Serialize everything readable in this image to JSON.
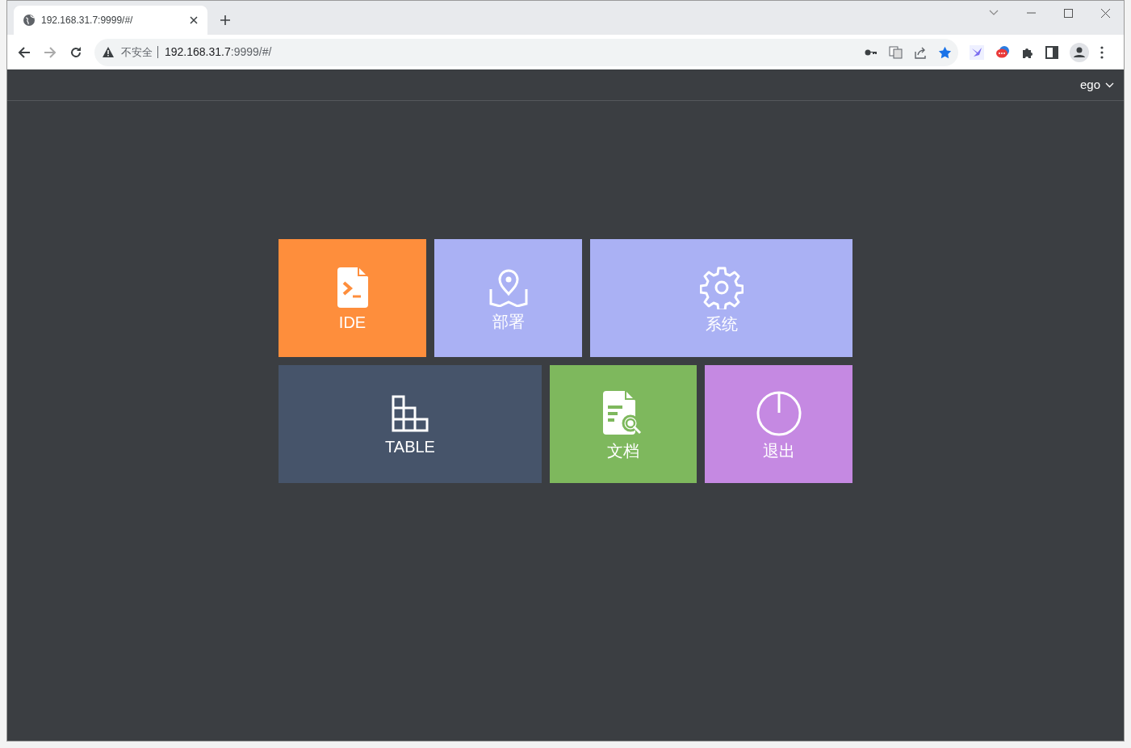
{
  "browser": {
    "tabs": [
      {
        "title": "192.168.31.7:9999/#/",
        "selected": true
      }
    ],
    "address_bar": {
      "security_label": "不安全",
      "host": "192.168.31.7",
      "path": ":9999/#/",
      "bookmarked": true
    }
  },
  "header": {
    "user_menu": "ego"
  },
  "tiles": [
    [
      {
        "kind": "ide",
        "label": "IDE",
        "color": "#fe8e3c"
      },
      {
        "kind": "deploy",
        "label": "部署",
        "color": "#aab1f4"
      },
      {
        "kind": "system",
        "label": "系统",
        "color": "#aab1f4"
      }
    ],
    [
      {
        "kind": "table",
        "label": "TABLE",
        "color": "#46546a"
      },
      {
        "kind": "docs",
        "label": "文档",
        "color": "#7eb85d"
      },
      {
        "kind": "logout",
        "label": "退出",
        "color": "#c589e2"
      }
    ]
  ]
}
